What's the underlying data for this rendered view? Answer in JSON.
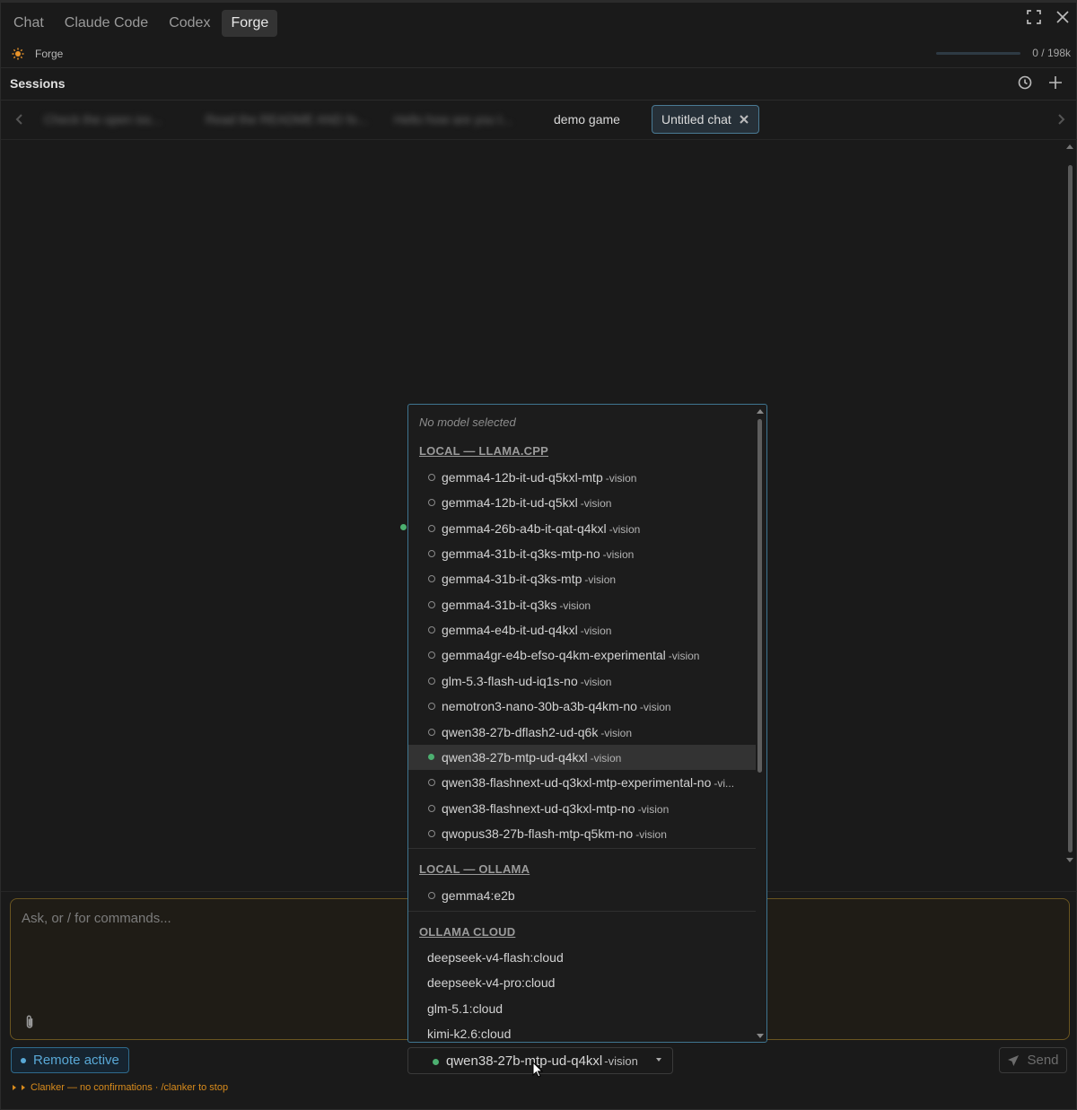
{
  "top_tabs": [
    {
      "label": "Chat",
      "active": false
    },
    {
      "label": "Claude Code",
      "active": false
    },
    {
      "label": "Codex",
      "active": false
    },
    {
      "label": "Forge",
      "active": true
    }
  ],
  "info": {
    "label": "Forge",
    "context": "0 / 198k"
  },
  "sessions": {
    "title": "Sessions",
    "tabs": [
      {
        "label": "Check the open iss..."
      },
      {
        "label": "Read the README AND fo..."
      },
      {
        "label": "Hello how are you t..."
      },
      {
        "label": "demo game"
      },
      {
        "label": "Untitled chat"
      }
    ]
  },
  "input": {
    "placeholder": "Ask, or / for commands..."
  },
  "controls": {
    "remote_label": "Remote active",
    "model_name": "qwen38-27b-mtp-ud-q4kxl",
    "model_suffix": "-vision",
    "send_label": "Send"
  },
  "status_line": "Clanker — no confirmations · /clanker to stop",
  "dropdown": {
    "none_label": "No model selected",
    "groups": [
      {
        "name": "LOCAL — LLAMA.CPP",
        "items": [
          {
            "name": "gemma4-12b-it-ud-q5kxl-mtp",
            "suffix": "-vision"
          },
          {
            "name": "gemma4-12b-it-ud-q5kxl",
            "suffix": "-vision"
          },
          {
            "name": "gemma4-26b-a4b-it-qat-q4kxl",
            "suffix": "-vision"
          },
          {
            "name": "gemma4-31b-it-q3ks-mtp-no",
            "suffix": "-vision"
          },
          {
            "name": "gemma4-31b-it-q3ks-mtp",
            "suffix": "-vision"
          },
          {
            "name": "gemma4-31b-it-q3ks",
            "suffix": "-vision"
          },
          {
            "name": "gemma4-e4b-it-ud-q4kxl",
            "suffix": "-vision"
          },
          {
            "name": "gemma4gr-e4b-efso-q4km-experimental",
            "suffix": "-vision"
          },
          {
            "name": "glm-5.3-flash-ud-iq1s-no",
            "suffix": "-vision"
          },
          {
            "name": "nemotron3-nano-30b-a3b-q4km-no",
            "suffix": "-vision"
          },
          {
            "name": "qwen38-27b-dflash2-ud-q6k",
            "suffix": "-vision"
          },
          {
            "name": "qwen38-27b-mtp-ud-q4kxl",
            "suffix": "-vision",
            "selected": true
          },
          {
            "name": "qwen38-flashnext-ud-q3kxl-mtp-experimental-no",
            "suffix": "-vi..."
          },
          {
            "name": "qwen38-flashnext-ud-q3kxl-mtp-no",
            "suffix": "-vision"
          },
          {
            "name": "qwopus38-27b-flash-mtp-q5km-no",
            "suffix": "-vision"
          }
        ]
      },
      {
        "name": "LOCAL — OLLAMA",
        "items": [
          {
            "name": "gemma4:e2b",
            "suffix": ""
          }
        ]
      },
      {
        "name": "OLLAMA CLOUD",
        "items": [
          {
            "name": "deepseek-v4-flash:cloud"
          },
          {
            "name": "deepseek-v4-pro:cloud"
          },
          {
            "name": "glm-5.1:cloud"
          },
          {
            "name": "kimi-k2.6:cloud"
          }
        ]
      }
    ]
  },
  "colors": {
    "accent": "#3f7590",
    "remote": "#59a8d6",
    "status": "#d88b1c",
    "online_dot": "#4caf70"
  }
}
